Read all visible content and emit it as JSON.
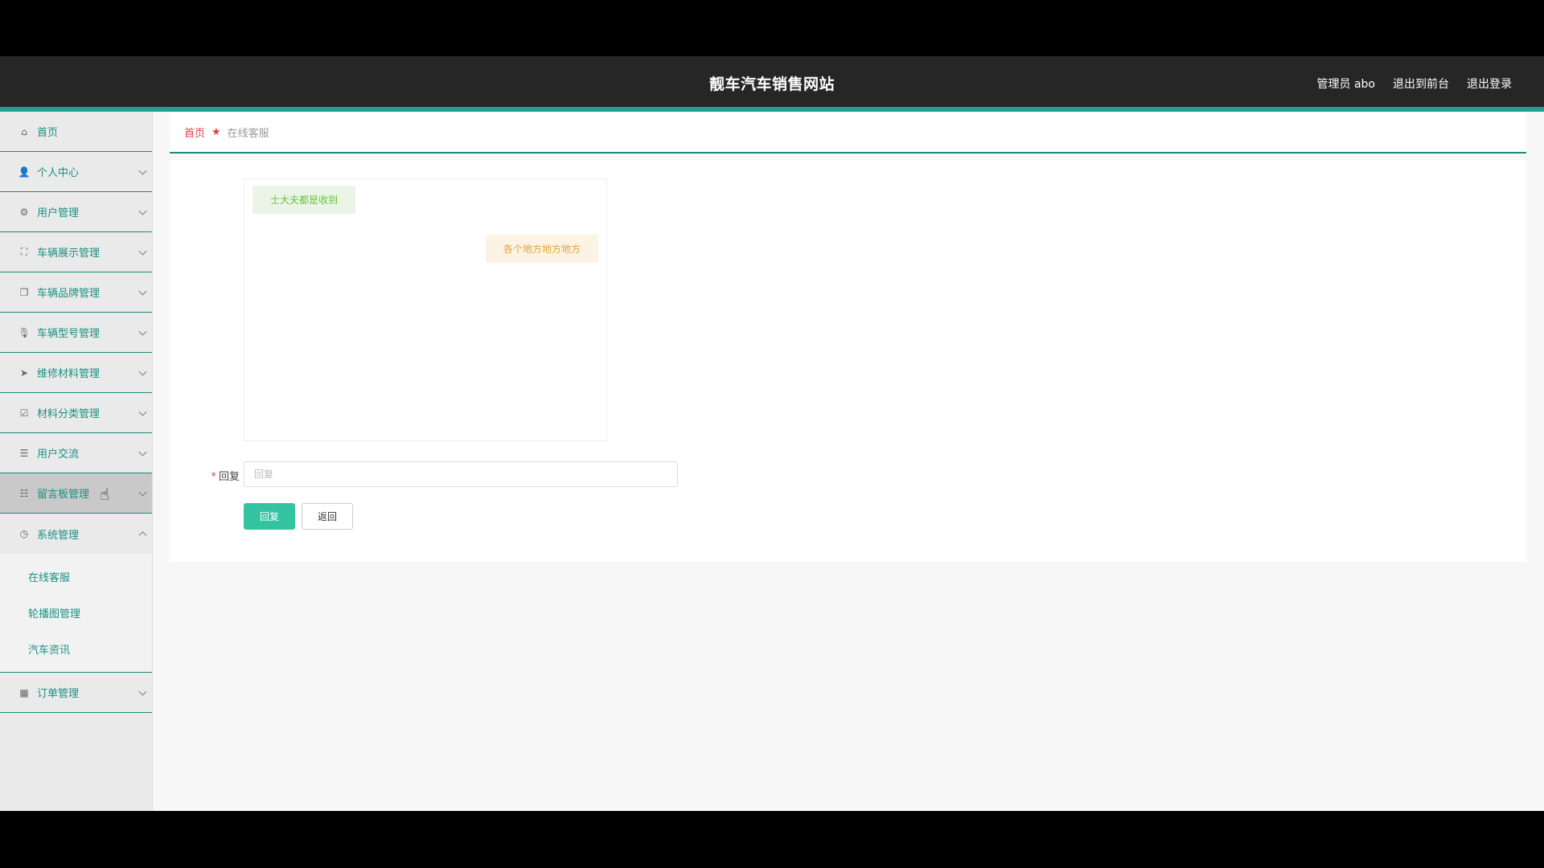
{
  "header": {
    "title": "靓车汽车销售网站",
    "admin_label": "管理员 abo",
    "to_front": "退出到前台",
    "logout": "退出登录",
    "accent_color": "#20a090"
  },
  "sidebar": {
    "items": [
      {
        "label": "首页",
        "icon": "home-icon"
      },
      {
        "label": "个人中心",
        "icon": "user-icon"
      },
      {
        "label": "用户管理",
        "icon": "gear-icon"
      },
      {
        "label": "车辆展示管理",
        "icon": "fullscreen-icon"
      },
      {
        "label": "车辆品牌管理",
        "icon": "copy-icon"
      },
      {
        "label": "车辆型号管理",
        "icon": "microphone-icon"
      },
      {
        "label": "维修材料管理",
        "icon": "paper-plane-icon"
      },
      {
        "label": "材料分类管理",
        "icon": "checkbox-icon"
      },
      {
        "label": "用户交流",
        "icon": "list-icon"
      },
      {
        "label": "留言板管理",
        "icon": "sliders-icon"
      },
      {
        "label": "系统管理",
        "icon": "clock-icon"
      },
      {
        "label": "订单管理",
        "icon": "grid-icon"
      }
    ],
    "system_sub": [
      "在线客服",
      "轮播图管理",
      "汽车资讯"
    ]
  },
  "breadcrumb": {
    "home": "首页",
    "current": "在线客服"
  },
  "chat": {
    "messages": [
      {
        "side": "left",
        "text": "士大夫都是收到"
      },
      {
        "side": "right",
        "text": "各个地方地方地方"
      }
    ]
  },
  "form": {
    "label": "回复",
    "required_mark": "*",
    "placeholder": "回复",
    "value": "",
    "submit_label": "回复",
    "back_label": "返回"
  }
}
